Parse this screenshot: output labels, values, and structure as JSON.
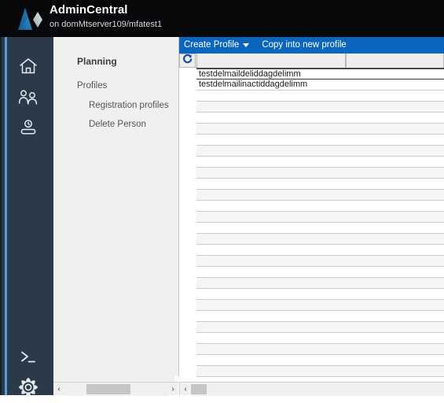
{
  "header": {
    "title": "AdminCentral",
    "subtitle": "on domMtserver109/mfatest1",
    "logo_icon": "adobe-triangle-logo-icon",
    "background_color": "#08080a"
  },
  "rail": {
    "background_color": "#2b3a4a",
    "accent_color": "#5b9bd5",
    "items": [
      {
        "icon": "home-icon",
        "name": "rail-item-home"
      },
      {
        "icon": "users-icon",
        "name": "rail-item-users"
      },
      {
        "icon": "person-badge-icon",
        "name": "rail-item-person"
      },
      {
        "icon": "terminal-icon",
        "name": "rail-item-terminal"
      },
      {
        "icon": "gear-icon",
        "name": "rail-item-settings"
      }
    ]
  },
  "nav": {
    "heading": "Planning",
    "items": [
      {
        "label": "Profiles",
        "level": 1
      },
      {
        "label": "Registration profiles",
        "level": 2
      },
      {
        "label": "Delete Person",
        "level": 2
      }
    ]
  },
  "toolbar": {
    "background_color": "#0a66bd",
    "create_profile_label": "Create Profile",
    "copy_into_new_profile_label": "Copy into new profile"
  },
  "table": {
    "refresh_icon": "refresh-icon",
    "columns": [
      "",
      ""
    ],
    "rows": [
      {
        "value": "testdelmaildeliddagdelimm",
        "selected": true
      },
      {
        "value": "testdelmailinactiddagdelimm",
        "selected": false
      }
    ],
    "empty_row_count": 26
  },
  "scrollbars": {
    "left_arrow_glyph": "‹",
    "right_arrow_glyph": "›",
    "left": {
      "name": "nav-horizontal-scrollbar"
    },
    "right": {
      "name": "table-horizontal-scrollbar"
    }
  }
}
